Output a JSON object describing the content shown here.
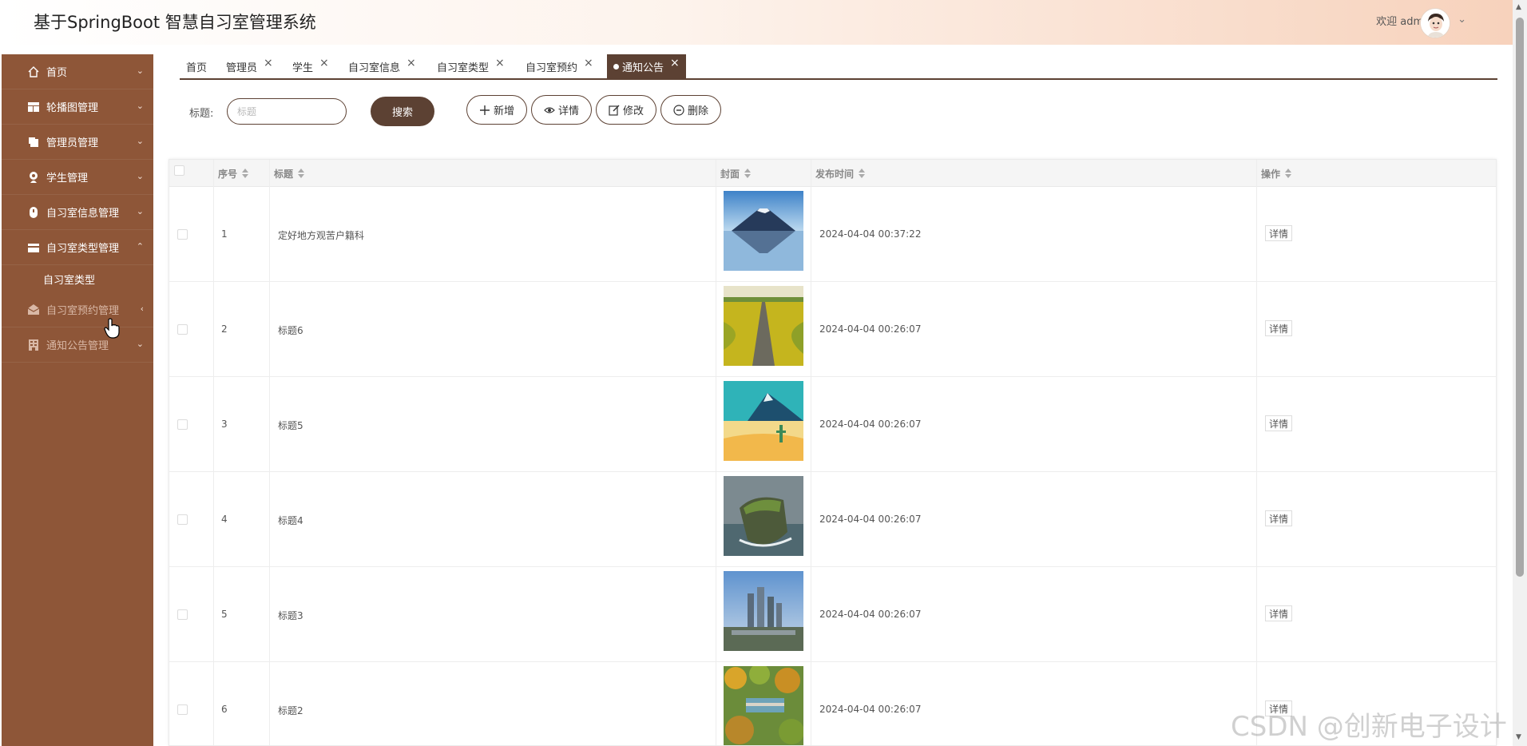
{
  "app": {
    "title": "基于SpringBoot 智慧自习室管理系统",
    "welcome": "欢迎 admin"
  },
  "colors": {
    "primary": "#5c4133",
    "sidebar_bg": "#8e5638",
    "header_gradient_end": "#f7d2bc"
  },
  "sidebar": {
    "items": [
      {
        "label": "首页",
        "icon": "home-icon"
      },
      {
        "label": "轮播图管理",
        "icon": "carousel-icon"
      },
      {
        "label": "管理员管理",
        "icon": "admin-icon"
      },
      {
        "label": "学生管理",
        "icon": "student-icon"
      },
      {
        "label": "自习室信息管理",
        "icon": "room-info-icon"
      },
      {
        "label": "自习室类型管理",
        "icon": "room-type-icon"
      },
      {
        "label": "自习室预约管理",
        "icon": "reservation-icon"
      },
      {
        "label": "通知公告管理",
        "icon": "notice-icon"
      }
    ],
    "submenu": {
      "label": "自习室类型"
    }
  },
  "tabs": [
    {
      "label": "首页"
    },
    {
      "label": "管理员"
    },
    {
      "label": "学生"
    },
    {
      "label": "自习室信息"
    },
    {
      "label": "自习室类型"
    },
    {
      "label": "自习室预约"
    },
    {
      "label": "通知公告",
      "active": true
    }
  ],
  "search": {
    "label": "标题:",
    "placeholder": "标题",
    "button": "搜索"
  },
  "actions": {
    "add": "新增",
    "detail": "详情",
    "edit": "修改",
    "delete": "删除"
  },
  "table": {
    "columns": [
      "序号",
      "标题",
      "封面",
      "发布时间",
      "操作"
    ],
    "detail_label": "详情",
    "rows": [
      {
        "no": "1",
        "title": "定好地方观苦户籍科",
        "time": "2024-04-04 00:37:22",
        "cover": "mountain-lake"
      },
      {
        "no": "2",
        "title": "标题6",
        "time": "2024-04-04 00:26:07",
        "cover": "field-road"
      },
      {
        "no": "3",
        "title": "标题5",
        "time": "2024-04-04 00:26:07",
        "cover": "illustration"
      },
      {
        "no": "4",
        "title": "标题4",
        "time": "2024-04-04 00:26:07",
        "cover": "island"
      },
      {
        "no": "5",
        "title": "标题3",
        "time": "2024-04-04 00:26:07",
        "cover": "city"
      },
      {
        "no": "6",
        "title": "标题2",
        "time": "2024-04-04 00:26:07",
        "cover": "garden"
      }
    ]
  },
  "watermark": "CSDN @创新电子设计"
}
